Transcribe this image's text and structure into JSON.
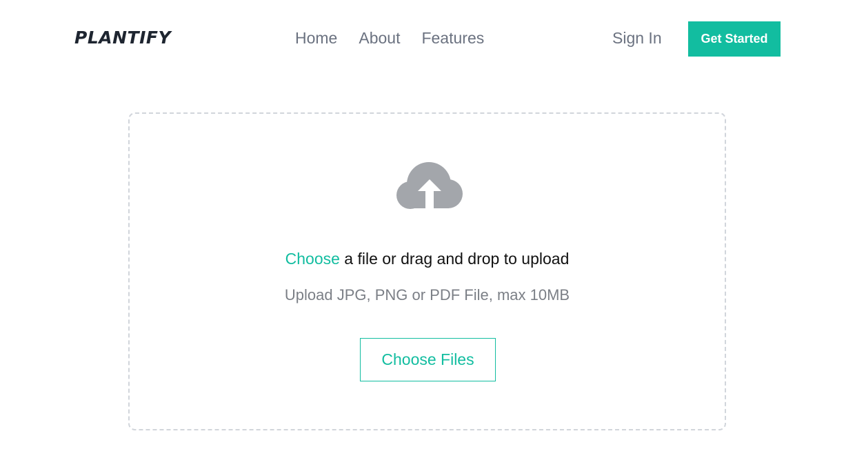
{
  "header": {
    "logo": "PLANTIFY",
    "nav": [
      "Home",
      "About",
      "Features"
    ],
    "sign_in": "Sign In",
    "cta": "Get Started"
  },
  "upload": {
    "icon": "cloud-upload-icon",
    "headline_link": "Choose",
    "headline_rest": " a file or drag and drop to upload",
    "hint": "Upload JPG, PNG or PDF File, max 10MB",
    "button": "Choose Files"
  },
  "colors": {
    "accent": "#12bda0",
    "logo": "#1e2530",
    "nav_text": "#6b7280",
    "icon": "#a3a6ab",
    "border": "#d1d5db"
  }
}
